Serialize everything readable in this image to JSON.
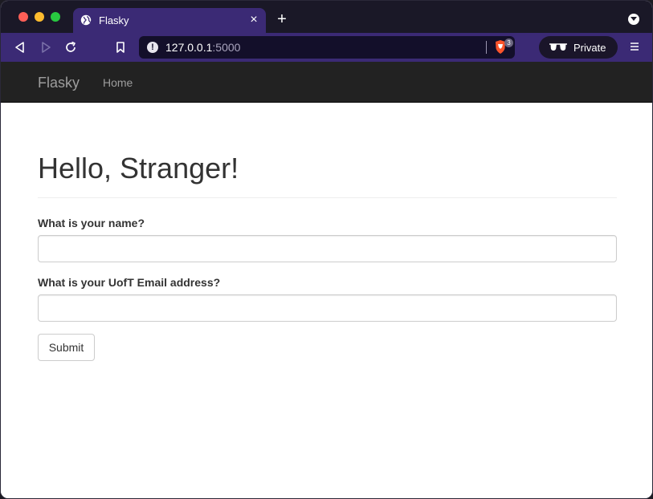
{
  "browser": {
    "tab": {
      "title": "Flasky",
      "close_glyph": "×"
    },
    "new_tab_glyph": "+",
    "url": {
      "host": "127.0.0.1",
      "port": ":5000"
    },
    "shield_badge_count": "3",
    "private_label": "Private",
    "colors": {
      "tab_active": "#3b2a75",
      "tabstrip": "#1a1827",
      "urlbar": "#130f2a"
    },
    "icons": [
      "back-icon",
      "forward-icon",
      "reload-icon",
      "bookmark-icon",
      "site-info-icon",
      "brave-shield-icon",
      "private-glasses-icon",
      "menu-icon",
      "tab-list-icon",
      "globe-icon"
    ]
  },
  "navbar": {
    "brand": "Flasky",
    "links": [
      {
        "label": "Home"
      }
    ]
  },
  "main": {
    "title": "Hello, Stranger!",
    "form": {
      "name_label": "What is your name?",
      "name_value": "",
      "email_label": "What is your UofT Email address?",
      "email_value": "",
      "submit_label": "Submit"
    }
  }
}
